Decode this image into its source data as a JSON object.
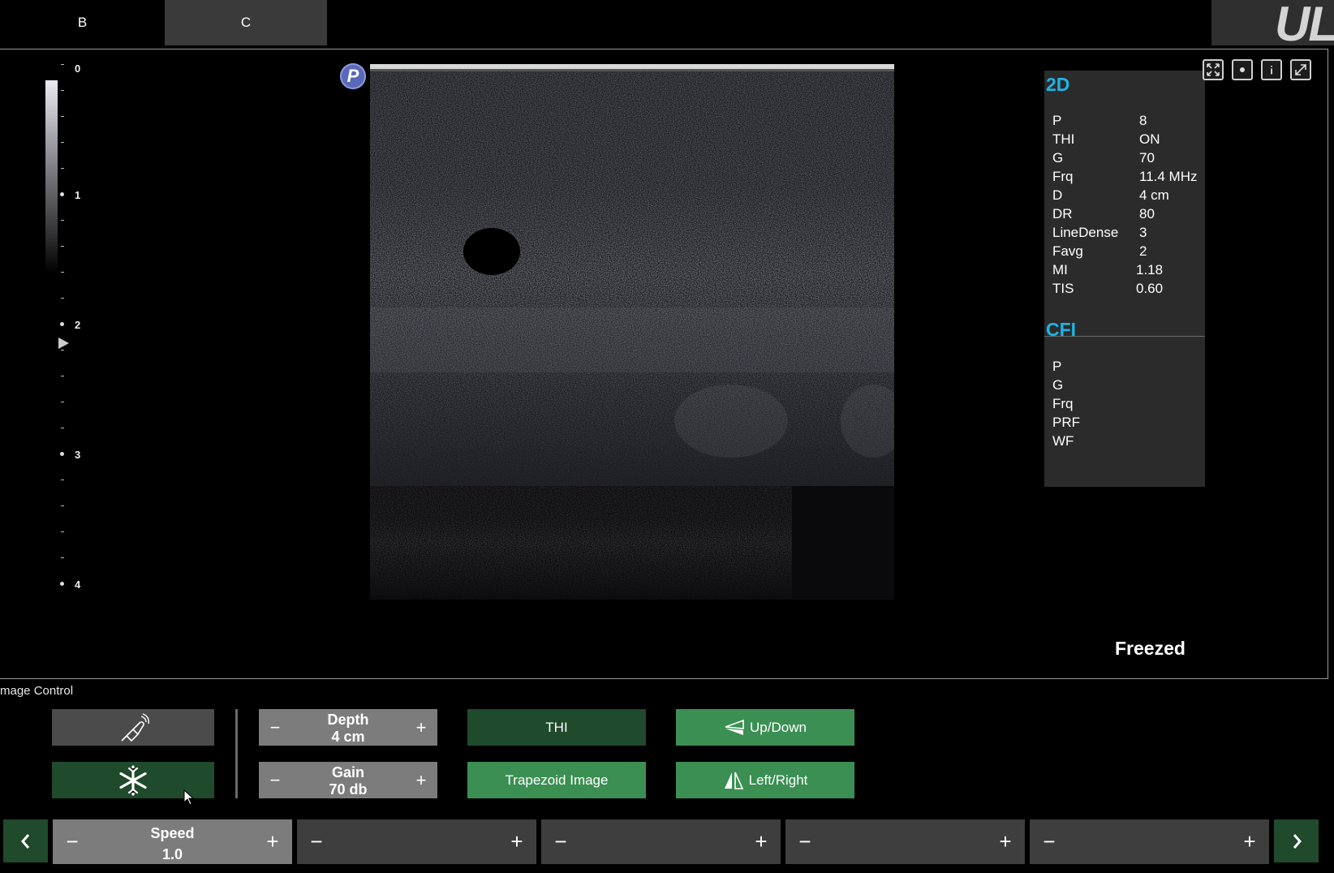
{
  "tabs": [
    {
      "label": "B"
    },
    {
      "label": "C"
    }
  ],
  "logo_text": "UL",
  "depth_scale": {
    "labels": [
      "0",
      "1",
      "2",
      "3",
      "4"
    ]
  },
  "badge": "P",
  "params_2d": {
    "title": "2D",
    "rows": [
      {
        "key": "P",
        "value": "8"
      },
      {
        "key": "THI",
        "value": "ON"
      },
      {
        "key": "G",
        "value": "70"
      },
      {
        "key": "Frq",
        "value": "11.4 MHz"
      },
      {
        "key": "D",
        "value": "4 cm"
      },
      {
        "key": "DR",
        "value": "80"
      },
      {
        "key": "LineDense",
        "value": "3"
      },
      {
        "key": "Favg",
        "value": "2"
      },
      {
        "key": "MI",
        "value": "1.18"
      },
      {
        "key": "TIS",
        "value": "0.60"
      }
    ]
  },
  "params_cfi": {
    "title": "CFI",
    "rows": [
      {
        "key": "P",
        "value": ""
      },
      {
        "key": "G",
        "value": ""
      },
      {
        "key": "Frq",
        "value": ""
      },
      {
        "key": "PRF",
        "value": ""
      },
      {
        "key": "WF",
        "value": ""
      }
    ]
  },
  "view_icons": [
    "fullscreen-icon",
    "record-icon",
    "info-icon",
    "expand-icon"
  ],
  "status": "Freezed",
  "image_control": {
    "label": "mage Control",
    "depth": {
      "title": "Depth",
      "value": "4 cm"
    },
    "gain": {
      "title": "Gain",
      "value": "70 db"
    },
    "thi": "THI",
    "trapezoid": "Trapezoid Image",
    "updown": "Up/Down",
    "leftright": "Left/Right"
  },
  "bottom_bar": {
    "speed": {
      "title": "Speed",
      "value": "1.0"
    }
  },
  "colors": {
    "accent_cyan": "#1eb4e6",
    "dark_green": "#1f4a2b",
    "light_green": "#3b8f53"
  }
}
